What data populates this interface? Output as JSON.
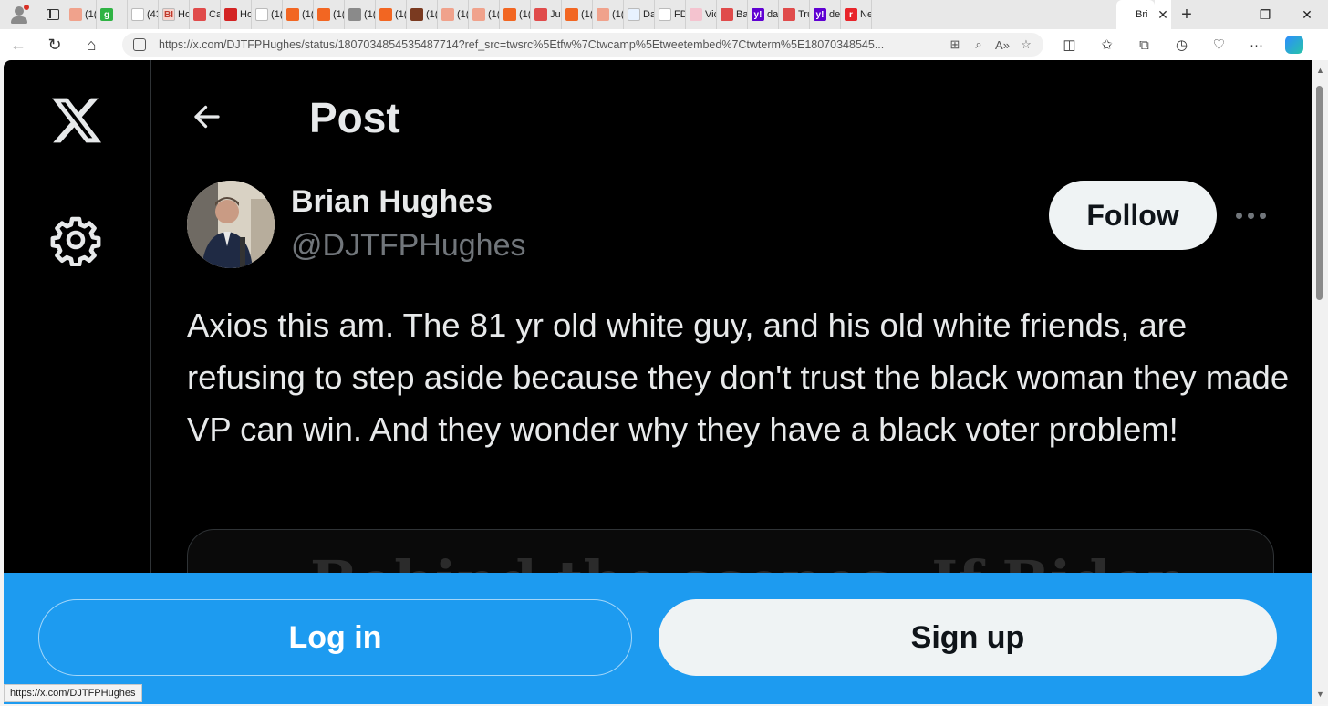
{
  "browser": {
    "tabs": [
      {
        "label": "(1(",
        "icon_color": "#f0a28c",
        "glyph": ""
      },
      {
        "label": "",
        "icon_color": "#2fb344",
        "glyph": "g"
      },
      {
        "label": "(43",
        "icon_color": "#ffffff",
        "glyph": ""
      },
      {
        "label": "Ho",
        "icon_color": "#f5d5cf",
        "glyph": "BI"
      },
      {
        "label": "Ca",
        "icon_color": "#e04b4b",
        "glyph": ""
      },
      {
        "label": "Ho",
        "icon_color": "#d32323",
        "glyph": ""
      },
      {
        "label": "(1(",
        "icon_color": "#ffffff",
        "glyph": ""
      },
      {
        "label": "(1(",
        "icon_color": "#f26622",
        "glyph": ""
      },
      {
        "label": "(1(",
        "icon_color": "#f26622",
        "glyph": ""
      },
      {
        "label": "(1(",
        "icon_color": "#8a8a8a",
        "glyph": ""
      },
      {
        "label": "(1(",
        "icon_color": "#f26622",
        "glyph": ""
      },
      {
        "label": "(1(",
        "icon_color": "#7a3a20",
        "glyph": ""
      },
      {
        "label": "(1(",
        "icon_color": "#f0a28c",
        "glyph": ""
      },
      {
        "label": "(1(",
        "icon_color": "#f0a28c",
        "glyph": ""
      },
      {
        "label": "(1(",
        "icon_color": "#f26622",
        "glyph": ""
      },
      {
        "label": "Jul",
        "icon_color": "#e04b4b",
        "glyph": ""
      },
      {
        "label": "(1(",
        "icon_color": "#f26622",
        "glyph": ""
      },
      {
        "label": "(1(",
        "icon_color": "#f0a28c",
        "glyph": ""
      },
      {
        "label": "Da",
        "icon_color": "#e8f2ff",
        "glyph": ""
      },
      {
        "label": "FD",
        "icon_color": "#ffffff",
        "glyph": ""
      },
      {
        "label": "Vic",
        "icon_color": "#f4c3cf",
        "glyph": ""
      },
      {
        "label": "Ba",
        "icon_color": "#e04b4b",
        "glyph": ""
      },
      {
        "label": "da",
        "icon_color": "#6001d2",
        "glyph": "y!"
      },
      {
        "label": "Tru",
        "icon_color": "#e04b4b",
        "glyph": ""
      },
      {
        "label": "de",
        "icon_color": "#6001d2",
        "glyph": "y!"
      },
      {
        "label": "Ne",
        "icon_color": "#e8252b",
        "glyph": "r"
      }
    ],
    "active_tab": {
      "label": "Bri"
    },
    "url": "https://x.com/DJTFPHughes/status/1807034854535487714?ref_src=twsrc%5Etfw%7Ctwcamp%5Etweetembed%7Ctwterm%5E18070348545..."
  },
  "page": {
    "header_title": "Post",
    "author": {
      "name": "Brian Hughes",
      "handle": "@DJTFPHughes"
    },
    "follow_label": "Follow",
    "post_text": "Axios this am. The 81 yr old white guy, and his old white friends, are refusing to step aside because they don't trust the black woman they made VP can win. And they wonder why they have a black voter problem!",
    "card_headline": "Behind the scenes: If Biden",
    "login_label": "Log in",
    "signup_label": "Sign up"
  },
  "status_url": "https://x.com/DJTFPHughes",
  "colors": {
    "x_blue": "#1d9bf0",
    "text_primary": "#e7e9ea",
    "text_secondary": "#71767b",
    "button_light": "#eff3f4"
  }
}
